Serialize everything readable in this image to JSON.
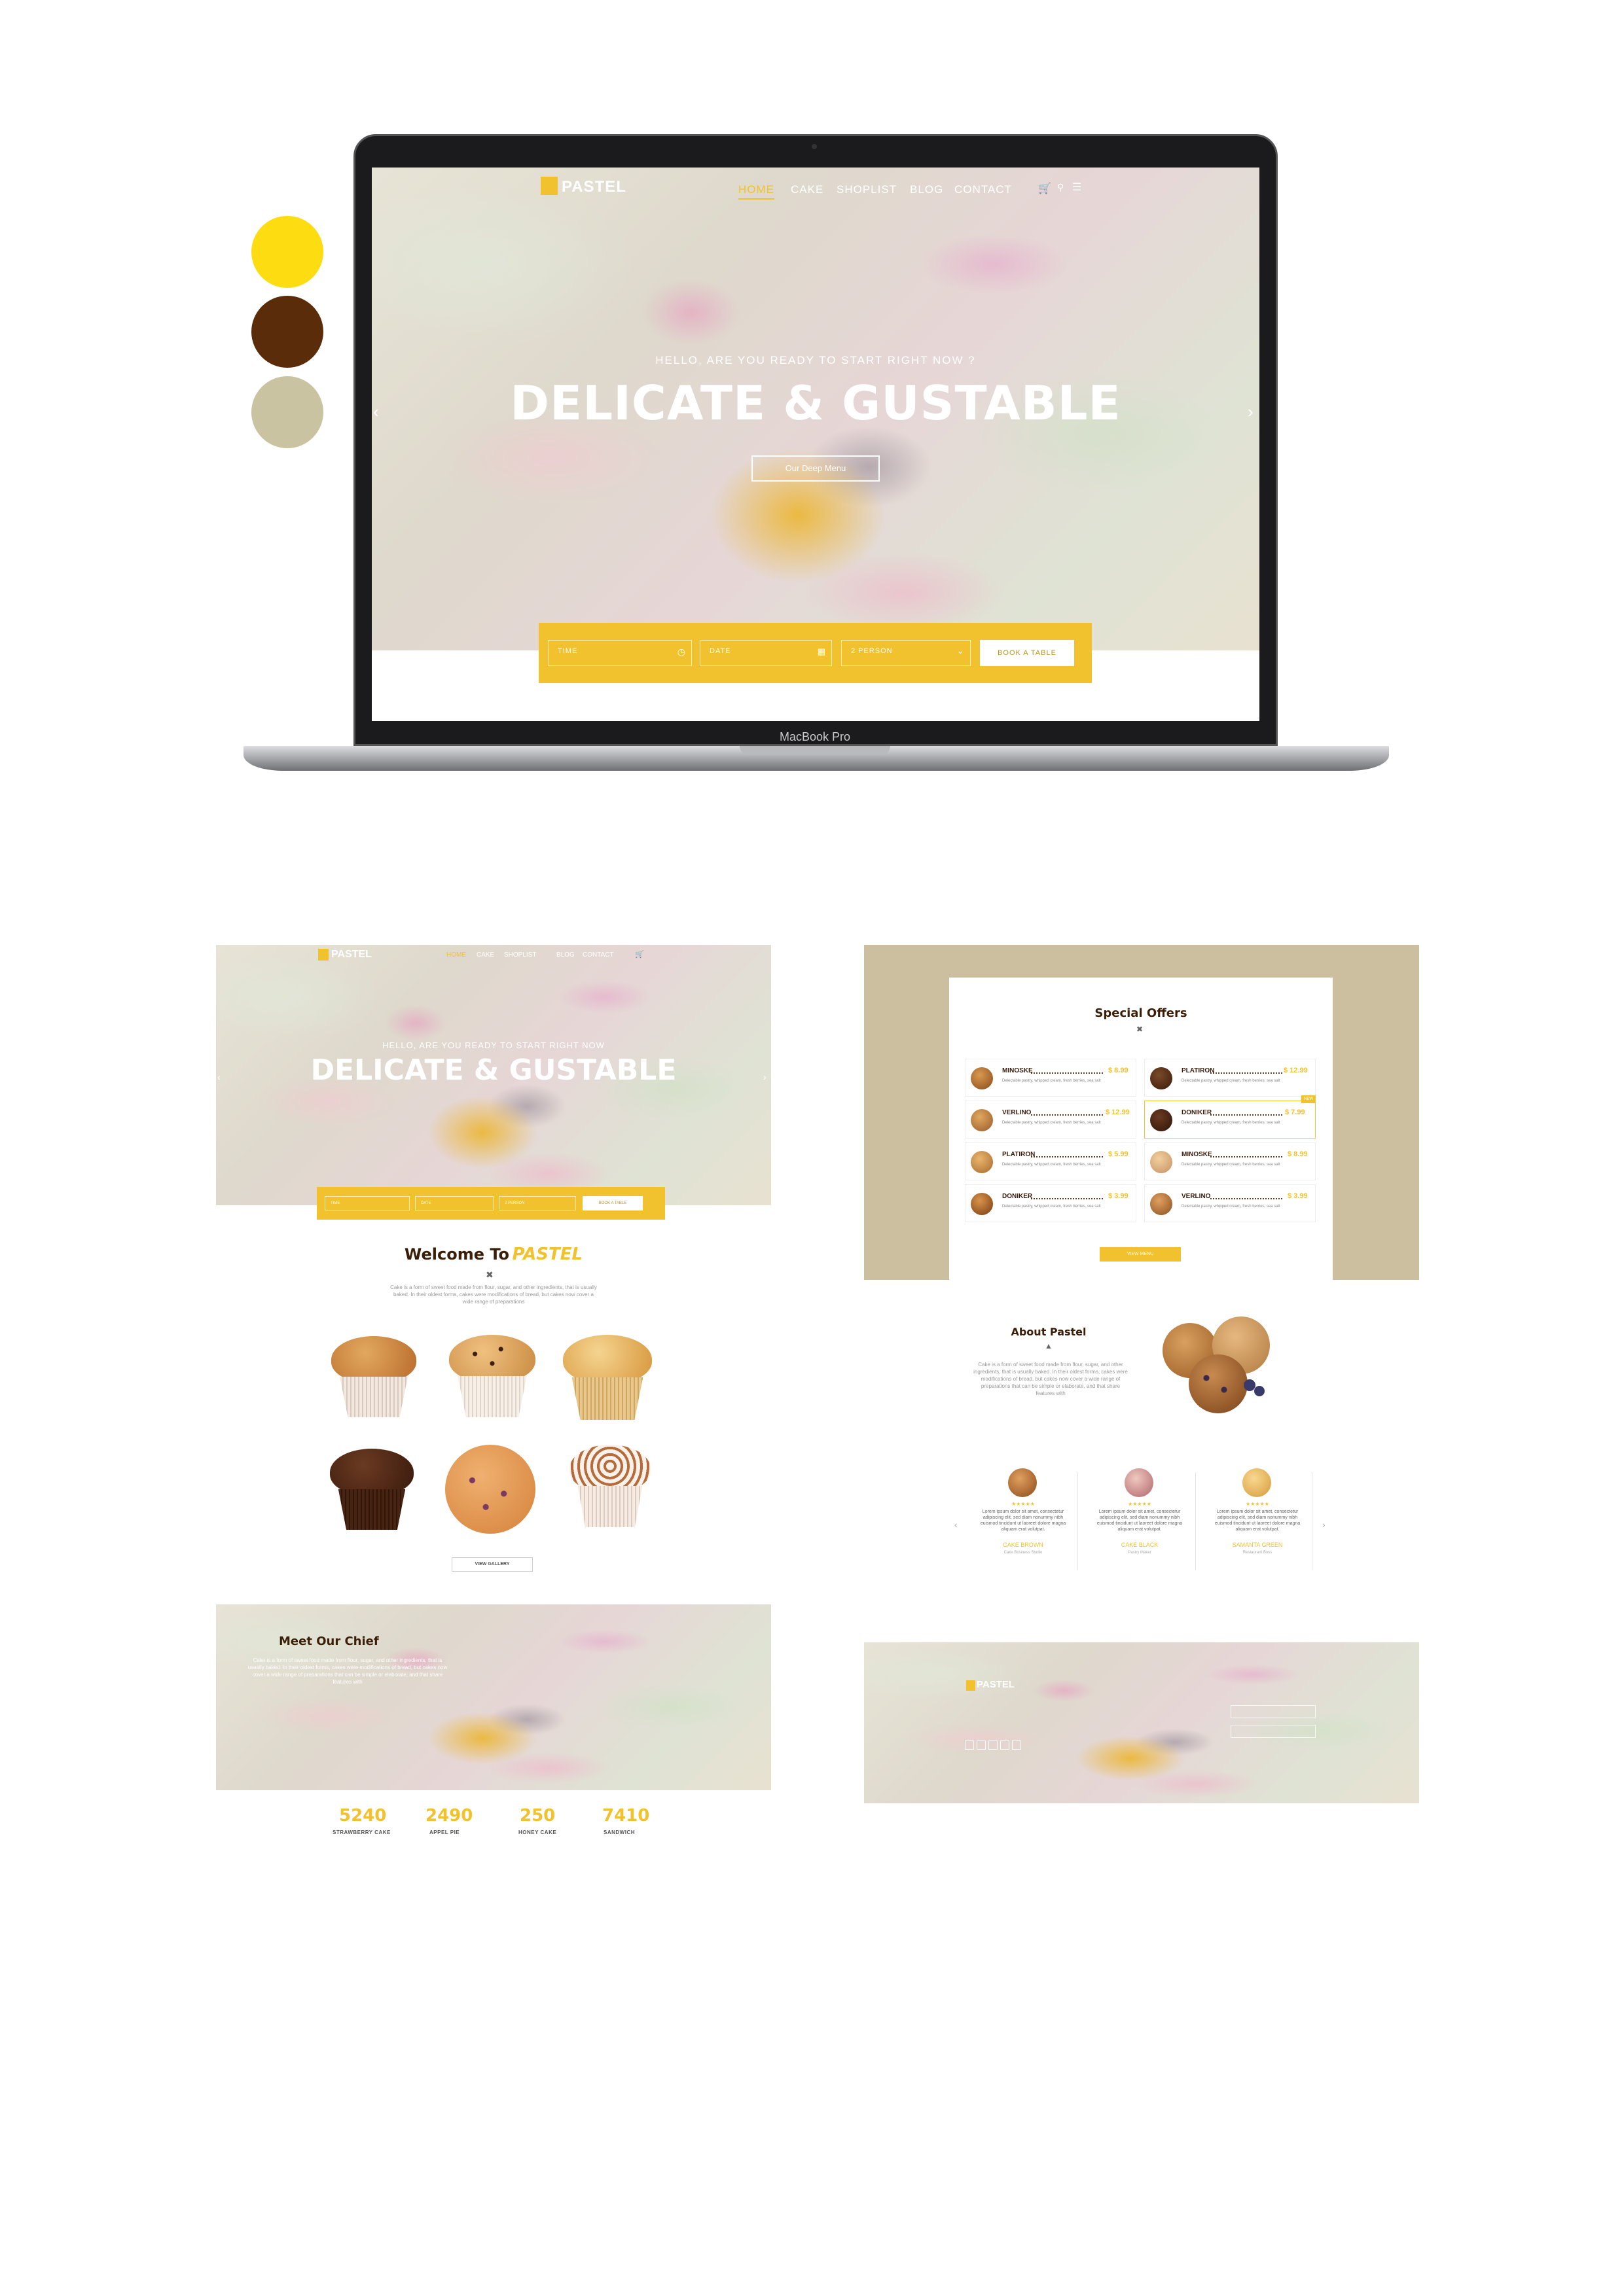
{
  "palette": {
    "swatches": [
      {
        "name": "yellow",
        "color": "#fddc12"
      },
      {
        "name": "brown",
        "color": "#5a2c0a"
      },
      {
        "name": "sage",
        "color": "#c9c3a1"
      }
    ]
  },
  "laptop": {
    "brand_text": "MacBook Pro",
    "site": {
      "logo": "PASTEL",
      "nav": [
        "HOME",
        "CAKE",
        "SHOPLIST",
        "BLOG",
        "CONTACT"
      ],
      "hero_subtitle": "HELLO, ARE YOU READY TO START RIGHT NOW ?",
      "hero_title": "DELICATE & GUSTABLE",
      "hero_button": "Our Deep Menu",
      "booking": {
        "time_placeholder": "TIME",
        "date_placeholder": "DATE",
        "person_value": "2 PERSON",
        "submit_label": "BOOK A TABLE"
      }
    }
  },
  "page_left": {
    "logo": "PASTEL",
    "nav": [
      "HOME",
      "CAKE",
      "SHOPLIST",
      "BLOG",
      "CONTACT"
    ],
    "hero_subtitle": "HELLO, ARE YOU READY TO START RIGHT NOW",
    "hero_title": "DELICATE & GUSTABLE",
    "booking": {
      "time_placeholder": "TIME",
      "date_placeholder": "DATE",
      "person_value": "2 PERSON",
      "submit_label": "BOOK A TABLE"
    },
    "welcome": {
      "title_prefix": "Welcome To",
      "title_brand": "PASTEL",
      "text": "Cake is a form of sweet food made from flour, sugar, and other ingredients, that is usually baked. In their oldest forms, cakes were modifications of bread, but cakes now cover a wide range of preparations",
      "button": "VIEW GALLERY"
    },
    "chief": {
      "title": "Meet Our Chief",
      "text": "Cake is a form of sweet food made from flour, sugar, and other ingredients, that is usually baked. In their oldest forms, cakes were modifications of bread, but cakes now cover a wide range of preparations that can be simple or elaborate, and that share features with"
    },
    "stats": [
      {
        "value": "5240",
        "label": "STRAWBERRY CAKE"
      },
      {
        "value": "2490",
        "label": "APPEL PIE"
      },
      {
        "value": "250",
        "label": "HONEY CAKE"
      },
      {
        "value": "7410",
        "label": "SANDWICH"
      }
    ]
  },
  "page_right": {
    "offers": {
      "title": "Special Offers",
      "items_left": [
        {
          "name": "MINOSKE",
          "price": "$ 8.99",
          "desc": "Delectable pastry, whipped cream, fresh berries, sea salt"
        },
        {
          "name": "VERLINO",
          "price": "$ 12.99",
          "desc": "Delectable pastry, whipped cream, fresh berries, sea salt"
        },
        {
          "name": "PLATIRON",
          "price": "$ 5.99",
          "desc": "Delectable pastry, whipped cream, fresh berries, sea salt"
        },
        {
          "name": "DONIKER",
          "price": "$ 3.99",
          "desc": "Delectable pastry, whipped cream, fresh berries, sea salt"
        }
      ],
      "items_right": [
        {
          "name": "PLATIRON",
          "price": "$ 12.99",
          "desc": "Delectable pastry, whipped cream, fresh berries, sea salt"
        },
        {
          "name": "DONIKER",
          "price": "$ 7.99",
          "desc": "Delectable pastry, whipped cream, fresh berries, sea salt"
        },
        {
          "name": "MINOSKE",
          "price": "$ 8.99",
          "desc": "Delectable pastry, whipped cream, fresh berries, sea salt"
        },
        {
          "name": "VERLINO",
          "price": "$ 3.99",
          "desc": "Delectable pastry, whipped cream, fresh berries, sea salt"
        }
      ],
      "badge": "NEW",
      "button": "VIEW MENU"
    },
    "about": {
      "title": "About Pastel",
      "text": "Cake is a form of sweet food made from flour, sugar, and other ingredients, that is usually baked. In their oldest forms, cakes were modifications of bread, but cakes now cover a wide range of preparations that can be simple or elaborate, and that share features with"
    },
    "testimonials": [
      {
        "stars": "★★★★★",
        "text": "Lorem ipsum dolor sit amet, consectetur adipiscing elit, sed diam nonummy nibh euismod tincidunt ut laoreet dolore magna aliquam erat volutpat.",
        "name": "CAKE BROWN",
        "role": "Cake Business Studio"
      },
      {
        "stars": "★★★★★",
        "text": "Lorem ipsum dolor sit amet, consectetur adipiscing elit, sed diam nonummy nibh euismod tincidunt ut laoreet dolore magna aliquam erat volutpat.",
        "name": "CAKE BLACK",
        "role": "Pastry Maker"
      },
      {
        "stars": "★★★★★",
        "text": "Lorem ipsum dolor sit amet, consectetur adipiscing elit, sed diam nonummy nibh euismod tincidunt ut laoreet dolore magna aliquam erat volutpat.",
        "name": "SAMANTA GREEN",
        "role": "Restaurant Boss"
      }
    ],
    "footer": {
      "logo": "PASTEL"
    }
  }
}
